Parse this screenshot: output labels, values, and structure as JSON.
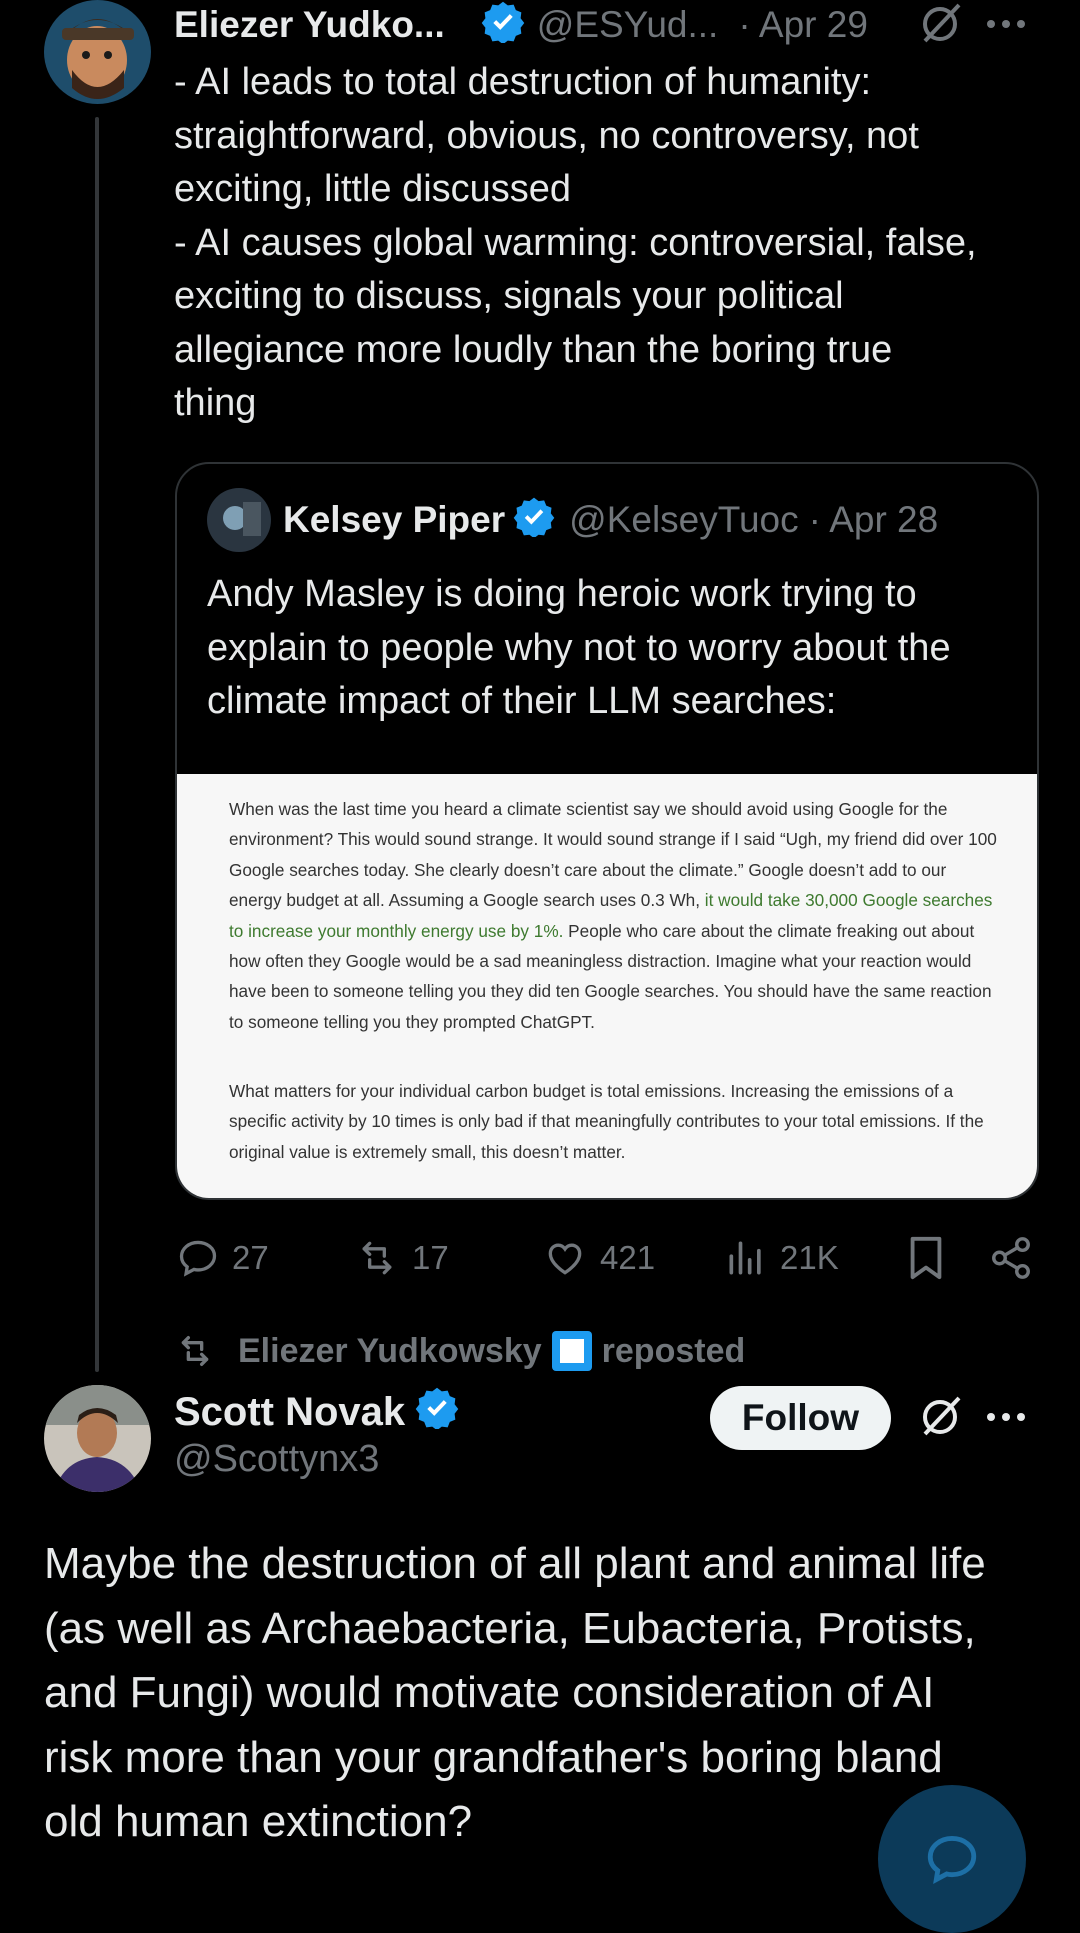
{
  "tweet1": {
    "name": "Eliezer Yudko...",
    "handle": "@ESYud...",
    "date": "· Apr 29",
    "lines": [
      "- AI leads to total destruction of humanity:",
      "straightforward, obvious, no controversy, not",
      "exciting, little discussed",
      "- AI causes global warming: controversial, false,",
      "exciting to discuss, signals your political",
      "allegiance more loudly than the boring true",
      "thing"
    ],
    "quote": {
      "name": "Kelsey Piper",
      "handle": "@KelseyTuoc",
      "date": "· Apr 28",
      "text": "Andy Masley is doing heroic work trying to explain to people why not to worry about the climate impact of their LLM searches:",
      "image_p1_a": "When was the last time you heard a climate scientist say we should avoid using Google for the environment? This would sound strange. It would sound strange if I said “Ugh, my friend did over 100 Google searches today. She clearly doesn’t care about the climate.” Google doesn’t add to our energy budget at all. Assuming a Google search uses 0.3 Wh, ",
      "image_p1_highlight": "it would take 30,000 Google searches to increase your monthly energy use by 1%.",
      "image_p1_b": " People who care about the climate freaking out about how often they Google would be a sad meaningless distraction. Imagine what your reaction would have been to someone telling you they did ten Google searches. You should have the same reaction to someone telling you they prompted ChatGPT.",
      "image_p2": "What matters for your individual carbon budget is total emissions. Increasing the emissions of a specific activity by 10 times is only bad if that meaningfully contributes to your total emissions. If the original value is extremely small, this doesn’t matter."
    },
    "actions": {
      "replies": "27",
      "reposts": "17",
      "likes": "421",
      "views": "21K"
    }
  },
  "repost_banner": {
    "name": "Eliezer Yudkowsky",
    "label": "reposted"
  },
  "tweet2": {
    "name": "Scott Novak",
    "handle": "@Scottynx3",
    "follow_label": "Follow",
    "text": "Maybe the destruction of all plant and animal life (as well as Archaebacteria, Eubacteria, Protists, and Fungi) would motivate consideration of AI risk more than your grandfather's boring bland old human extinction?"
  },
  "colors": {
    "background": "#000000",
    "text": "#e7e9ea",
    "muted": "#71767b",
    "verified": "#1d9bf0",
    "fab": "#0c3a59"
  }
}
